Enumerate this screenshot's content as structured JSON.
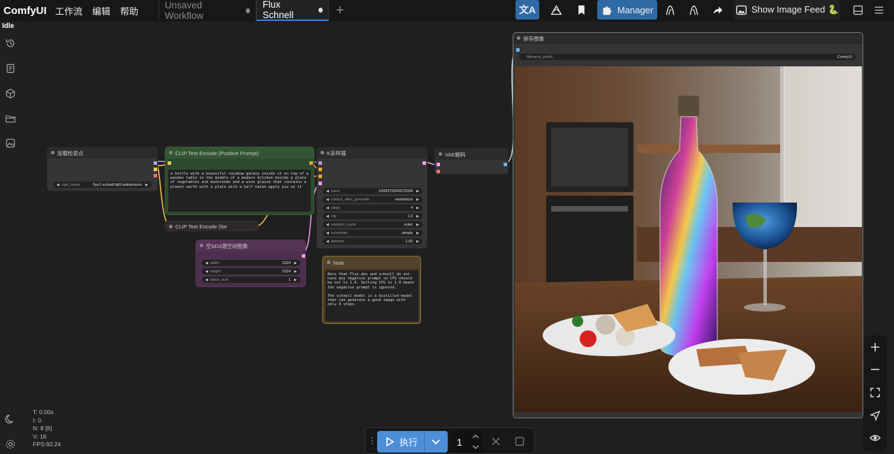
{
  "app": {
    "logo": "ComfyUI",
    "menu": [
      "工作流",
      "编辑",
      "帮助"
    ],
    "status": "Idle"
  },
  "tabs": [
    {
      "label": "Unsaved Workflow",
      "active": false
    },
    {
      "label": "Flux Schnell",
      "active": true
    }
  ],
  "toolbar": {
    "manager_label": "Manager",
    "image_feed_label": "Show Image Feed 🐍"
  },
  "colors": {
    "accent": "#4d8ed8",
    "clip_node": "#335533",
    "latent_node": "#553355",
    "note_node": "#443322",
    "clip_link": "#f5c84c",
    "model_link": "#b39ddb",
    "latent_link": "#ff9cf9",
    "image_link": "#64b5f6"
  },
  "nodes": {
    "checkpoint": {
      "title": "加载检查点",
      "ckpt_name_label": "ckpt_name",
      "ckpt_name_value": "flux1-schnell-fp8.safetensors"
    },
    "clip_positive": {
      "title": "CLIP Text Encode (Positive Prompt)",
      "prompt": "a bottle with a beautiful rainbow galaxy inside it on top of a wooden table in the middle of a modern kitchen beside a plate of vegetables and mushrooms and a wine glasse that contains a planet earth with a plate with a half eaten apple pie on it"
    },
    "clip_negative": {
      "title": "CLIP Text Encode (Ne"
    },
    "latent": {
      "title": "空SD3潜空间图像",
      "widgets": [
        {
          "label": "width",
          "value": "1024"
        },
        {
          "label": "height",
          "value": "1024"
        },
        {
          "label": "batch_size",
          "value": "1"
        }
      ]
    },
    "ksampler": {
      "title": "K采样器",
      "widgets": [
        {
          "label": "seed",
          "value": "1008370505972036"
        },
        {
          "label": "control_after_generate",
          "value": "randomize"
        },
        {
          "label": "steps",
          "value": "4"
        },
        {
          "label": "cfg",
          "value": "1.0"
        },
        {
          "label": "sampler_name",
          "value": "euler"
        },
        {
          "label": "scheduler",
          "value": "simple"
        },
        {
          "label": "denoise",
          "value": "1.00"
        }
      ]
    },
    "note": {
      "title": "Note",
      "text": "Note that Flux dev and schnell do not have any negative prompt so CFG should be set to 1.0. Setting CFG to 1.0 means the negative prompt is ignored.\n\nThe schnell model is a distilled model that can generate a good image with only 4 steps."
    },
    "vae_decode": {
      "title": "VAE解码"
    },
    "save_image": {
      "title": "保存图像",
      "prefix_label": "filename_prefix",
      "prefix_value": "ComfyUI"
    }
  },
  "stats": {
    "t": "T: 0.00s",
    "i": "I: 0",
    "n": "N: 8 [8]",
    "v": "V: 16",
    "fps": "FPS:60.24"
  },
  "run": {
    "label": "执行",
    "batch_count": "1"
  },
  "icons": {
    "translate": "translate-icon",
    "bookmark": "bookmark-icon",
    "puzzle": "puzzle-icon",
    "history": "history-icon",
    "queue": "queue-icon",
    "cube": "model-library-icon",
    "folder": "workflow-folder-icon",
    "image": "image-icon",
    "moon": "theme-moon-icon",
    "settings": "gear-icon"
  }
}
